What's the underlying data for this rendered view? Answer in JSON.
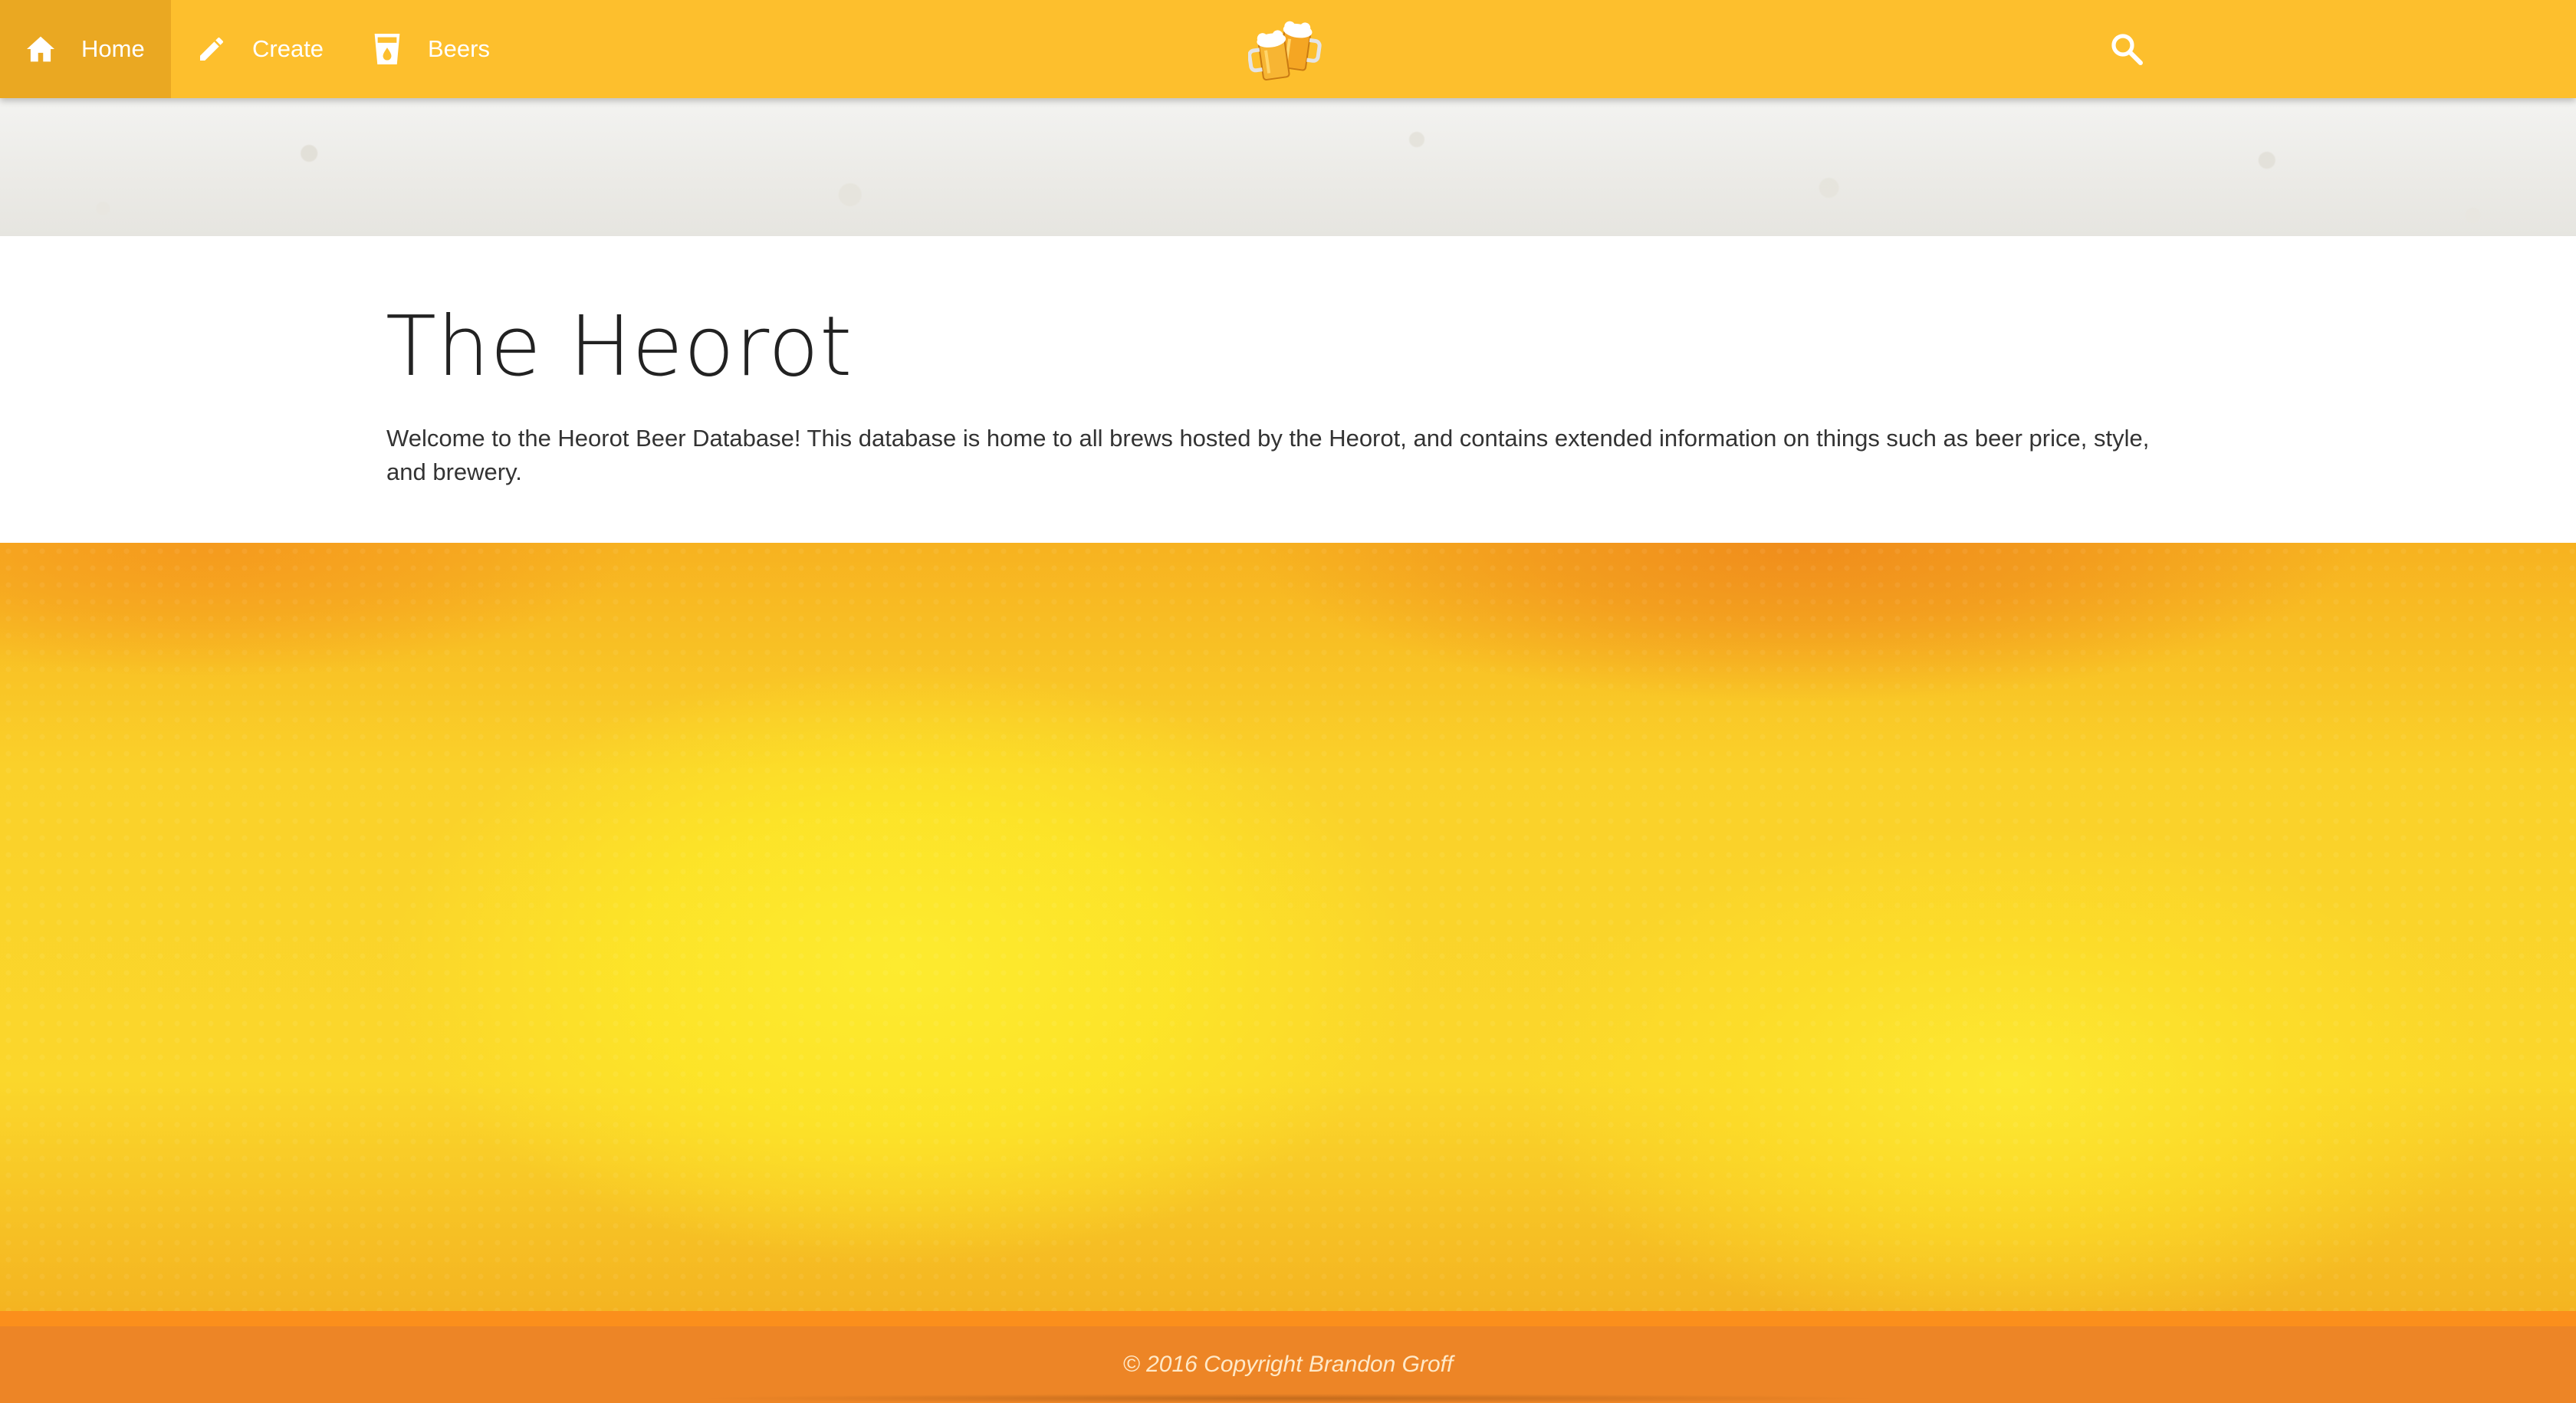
{
  "nav": {
    "items": [
      {
        "label": "Home",
        "icon": "home-icon",
        "active": true
      },
      {
        "label": "Create",
        "icon": "pencil-icon",
        "active": false
      },
      {
        "label": "Beers",
        "icon": "beer-glass-icon",
        "active": false
      }
    ],
    "logo_icon": "beer-mugs-icon",
    "search_icon": "search-icon"
  },
  "main": {
    "title": "The Heorot",
    "description": "Welcome to the Heorot Beer Database! This database is home to all brews hosted by the Heorot, and contains extended information on things such as beer price, style, and brewery."
  },
  "footer": {
    "copyright": "© 2016 Copyright Brandon Groff"
  },
  "colors": {
    "navbar": "#fdbf2d",
    "nav_active": "#eaa822",
    "footer": "#ed8526",
    "footer_stripe": "#fb8f1c"
  }
}
